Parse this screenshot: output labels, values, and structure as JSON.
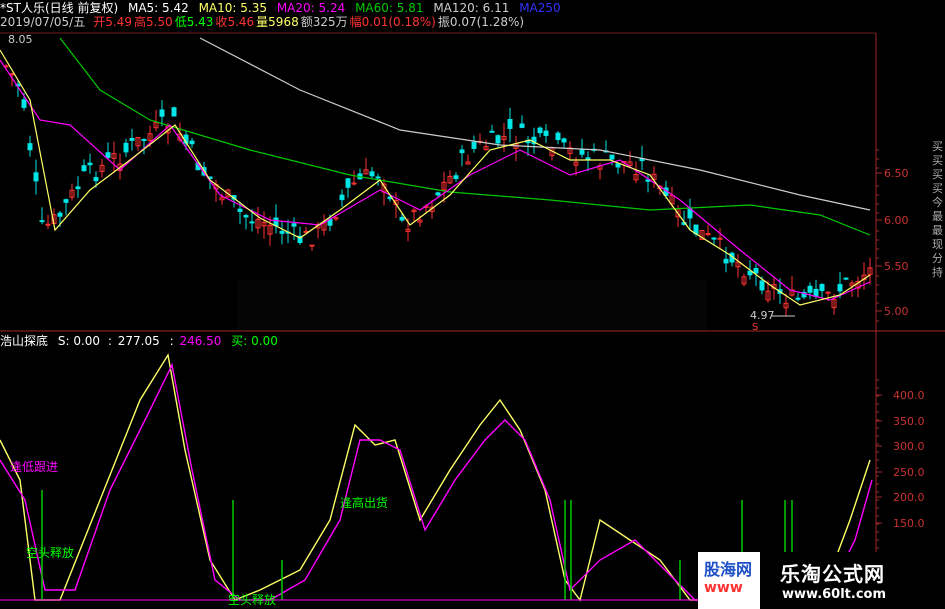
{
  "header": {
    "title": "*ST人乐(日线 前复权)",
    "ma5": "MA5: 5.42",
    "ma10": "MA10: 5.35",
    "ma20": "MA20: 5.24",
    "ma60": "MA60: 5.81",
    "ma120": "MA120: 6.11",
    "ma250": "MA250",
    "date": "2019/07/05/五",
    "open_label": "开",
    "open": "5.49",
    "high_label": "高",
    "high": "5.50",
    "low_label": "低",
    "low": "5.43",
    "close_label": "收",
    "close": "5.46",
    "vol_label": "量",
    "vol": "5968",
    "amount_label": "额",
    "amount": "325万",
    "change_label": "幅",
    "change": "0.01(0.18%)",
    "amp_label": "振",
    "amp": "0.07(1.28%)"
  },
  "price_panel": {
    "max_marker": "8.05",
    "min_marker": "4.97",
    "s_marker": "S",
    "y_ticks": [
      "6.50",
      "6.00",
      "5.50",
      "5.00"
    ]
  },
  "indicator_panel": {
    "name": "浩山探底",
    "s_value": "S: 0.00",
    "v1": "277.05",
    "v2": "246.50",
    "buy": "买: 0.00",
    "y_ticks": [
      "400.0",
      "350.0",
      "300.0",
      "250.0",
      "200.0",
      "150.0"
    ],
    "annotations": {
      "a1": "逢低跟进",
      "a2": "逢高出货",
      "a3": "空头释放",
      "a4": "空头释放"
    }
  },
  "side_text": "买 买 买 买 今 最 最 现 分 持",
  "watermark_left": "股海网",
  "watermark_left_url": "www",
  "watermark_right": "乐淘公式网",
  "watermark_right_url": "www.60lt.com",
  "colors": {
    "red": "#ff3232",
    "cyan": "#00ffff",
    "yellow": "#ffff66",
    "magenta": "#ff00ff",
    "green": "#00c800",
    "white": "#cccccc",
    "axis": "#c83232"
  }
}
